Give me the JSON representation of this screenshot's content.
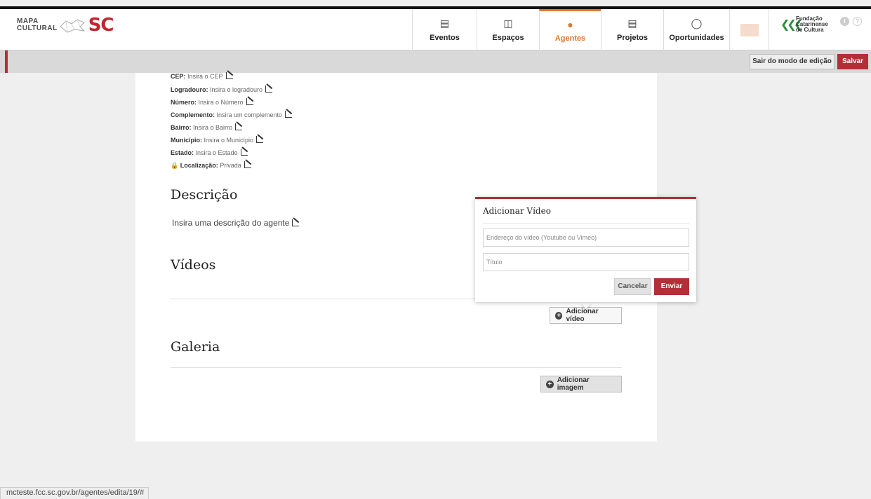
{
  "logo": {
    "line1": "MAPA",
    "line2": "CULTURAL",
    "brand": "SC"
  },
  "nav": [
    {
      "label": "Eventos",
      "icon": "calendar-icon"
    },
    {
      "label": "Espaços",
      "icon": "building-icon"
    },
    {
      "label": "Agentes",
      "icon": "person-icon"
    },
    {
      "label": "Projetos",
      "icon": "document-icon"
    },
    {
      "label": "Oportunidades",
      "icon": "lightbulb-icon"
    }
  ],
  "fcc": {
    "line1": "Fundação",
    "line2": "Catarinense",
    "line3": "de Cultura"
  },
  "editbar": {
    "exit_label": "Sair do modo de edição",
    "save_label": "Salvar"
  },
  "address": [
    {
      "label": "CEP:",
      "value": "Insira o CEP"
    },
    {
      "label": "Logradouro:",
      "value": "Insira o logradouro"
    },
    {
      "label": "Número:",
      "value": "Insira o Número"
    },
    {
      "label": "Complemento:",
      "value": "Insira um complemento"
    },
    {
      "label": "Bairro:",
      "value": "Insira o Bairro"
    },
    {
      "label": "Município:",
      "value": "Insira o Município"
    },
    {
      "label": "Estado:",
      "value": "Insira o Estado"
    },
    {
      "label": "Localização:",
      "value": "Privada"
    }
  ],
  "description": {
    "title": "Descrição",
    "placeholder": "Insira uma descrição do agente"
  },
  "videos": {
    "title": "Vídeos",
    "add_label": "Adicionar vídeo"
  },
  "gallery": {
    "title": "Galeria",
    "add_label": "Adicionar imagem"
  },
  "popup": {
    "title": "Adicionar Vídeo",
    "url_placeholder": "Endereço do vídeo (Youtube ou Vimeo)",
    "title_placeholder": "Título",
    "cancel_label": "Cancelar",
    "send_label": "Enviar"
  },
  "statusbar": {
    "url": "mcteste.fcc.sc.gov.br/agentes/edita/19/#"
  },
  "colors": {
    "accent": "#e1762b",
    "danger": "#b13036",
    "fcc_green": "#2f8d3c"
  }
}
